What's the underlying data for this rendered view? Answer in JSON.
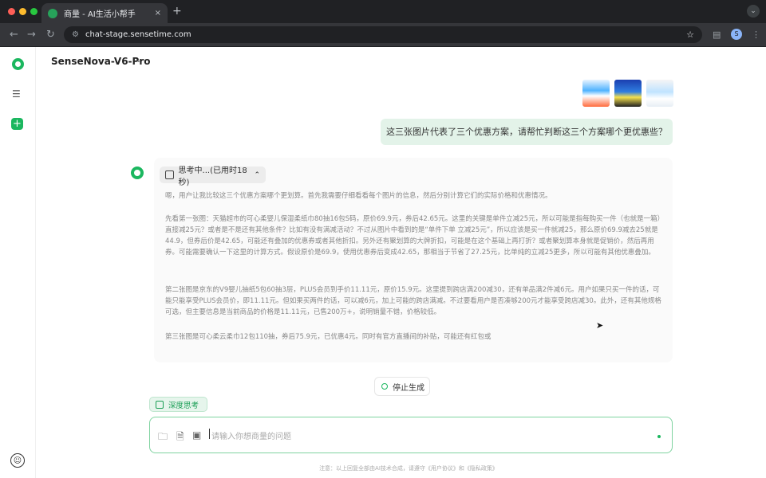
{
  "browser": {
    "tab_title": "商量 - AI生活小帮手",
    "tab_close": "×",
    "new_tab": "+",
    "url": "chat-stage.sensetime.com",
    "profile_initial": "S"
  },
  "header": {
    "model_name": "SenseNova-V6-Pro",
    "caret": "⌄"
  },
  "sidebar": {
    "new_chat_icon": "+",
    "toggle_icon": "☰"
  },
  "user_message": {
    "text": "这三张图片代表了三个优惠方案，请帮忙判断这三个方案哪个更优惠些？"
  },
  "assistant": {
    "thinking_label": "思考中...(已用时18秒)",
    "thinking_caret": "⌃",
    "paragraphs": [
      "嗯，用户让我比较这三个优惠方案哪个更划算。首先我需要仔细看看每个图片的信息，然后分别计算它们的实际价格和优惠情况。",
      "先看第一张图：天猫超市的可心柔婴儿保湿柔纸巾80抽16包S码，原价69.9元，券后42.65元。这里的关键是单件立减25元，所以可能是指每购买一件（也就是一箱）直接减25元？或者是不是还有其他条件？比如有没有满减活动？不过从图片中看到的是“单件下单 立减25元”，所以应该是买一件就减25，那么原价69.9减去25就是44.9，但券后价是42.65，可能还有叠加的优惠券或者其他折扣。另外还有聚划算的大牌折扣，可能是在这个基础上再打折？或者聚划算本身就是促销价，然后再用券。可能需要确认一下这里的计算方式。假设原价是69.9，使用优惠券后变成42.65，那相当于节省了27.25元，比单纯的立减25更多，所以可能有其他优惠叠加。",
      "第二张图是京东的V9婴儿抽纸5包60抽3层，PLUS会员到手价11.11元，原价15.9元。这里提到跨店满200减30，还有单品满2件减6元。用户如果只买一件的话，可能只能享受PLUS会员价，即11.11元。但如果买两件的话，可以减6元，加上可能的跨店满减。不过要看用户是否凑够200元才能享受跨店减30。此外，还有其他规格可选，但主要信息是当前商品的价格是11.11元，已售200万+，说明销量不错，价格较低。",
      "第三张图是可心柔云柔巾12包110抽，券后75.9元，已优惠4元。同时有官方直播间的补贴，可能还有红包或"
    ],
    "stop_label": "停止生成"
  },
  "composer": {
    "deep_think_label": "深度思考",
    "placeholder": "请输入你想商量的问题"
  },
  "footer": {
    "text": "注意：以上回复全部由AI技术合成，请遵守《用户协议》和《隐私政策》"
  },
  "colors": {
    "accent": "#1bb75f",
    "user_bubble": "#e3f3e9"
  }
}
